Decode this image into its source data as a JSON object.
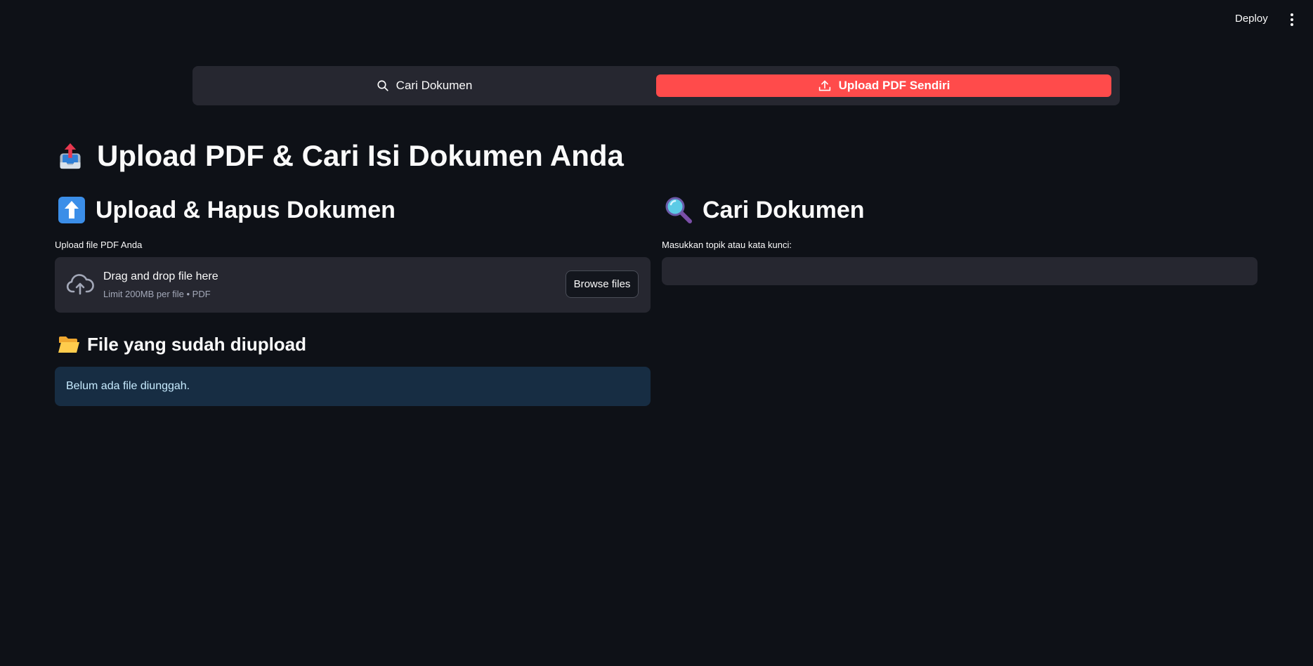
{
  "header": {
    "deploy_label": "Deploy"
  },
  "nav": {
    "tabs": [
      {
        "label": "Cari Dokumen",
        "icon": "search-icon",
        "active": false
      },
      {
        "label": "Upload PDF Sendiri",
        "icon": "upload-icon",
        "active": true
      }
    ],
    "active_color": "#ff4b4b"
  },
  "page": {
    "title": "Upload PDF & Cari Isi Dokumen Anda",
    "title_icon": "inbox-tray-icon"
  },
  "upload_section": {
    "heading": "Upload & Hapus Dokumen",
    "heading_icon": "up-arrow-icon",
    "uploader_label": "Upload file PDF Anda",
    "dropzone_title": "Drag and drop file here",
    "dropzone_hint": "Limit 200MB per file • PDF",
    "browse_label": "Browse files"
  },
  "search_section": {
    "heading": "Cari Dokumen",
    "heading_icon": "magnifying-glass-icon",
    "input_label": "Masukkan topik atau kata kunci:",
    "input_value": ""
  },
  "files_section": {
    "heading": "File yang sudah diupload",
    "heading_icon": "open-folder-icon",
    "empty_message": "Belum ada file diunggah."
  }
}
